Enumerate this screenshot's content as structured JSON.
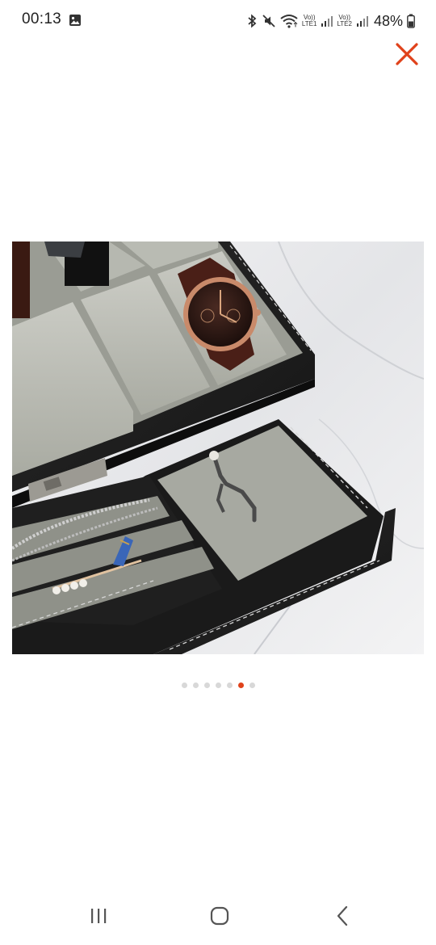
{
  "status_bar": {
    "time": "00:13",
    "lte1_top": "Vo))",
    "lte1_bottom": "LTE1",
    "lte2_top": "Vo))",
    "lte2_bottom": "LTE2",
    "battery": "48%"
  },
  "gallery": {
    "total_images": 7,
    "active_index": 5,
    "active_color": "#e0421b",
    "inactive_color": "#d8d8d8"
  },
  "close_color": "#e0421b",
  "nav": {
    "recents": "recents-icon",
    "home": "home-icon",
    "back": "back-icon"
  }
}
